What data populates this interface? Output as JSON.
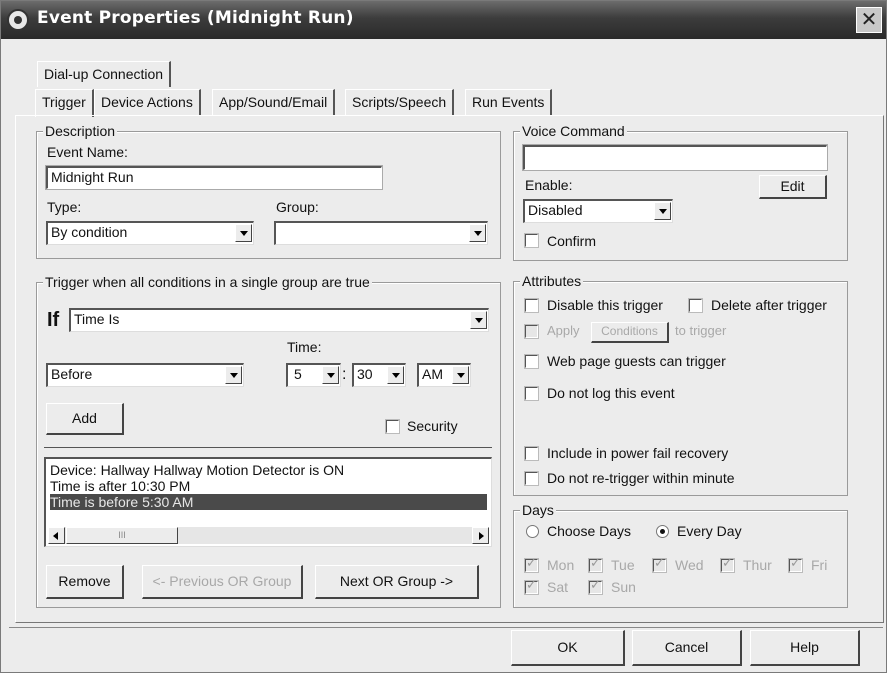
{
  "window": {
    "title": "Event Properties (Midnight Run)",
    "close_glyph": "✕"
  },
  "tabs_upper": [
    "Dial-up Connection"
  ],
  "tabs_lower": [
    "Trigger",
    "Device Actions",
    "App/Sound/Email",
    "Scripts/Speech",
    "Run Events"
  ],
  "active_tab": "Trigger",
  "description": {
    "legend": "Description",
    "event_name_label": "Event Name:",
    "event_name_value": "Midnight Run",
    "type_label": "Type:",
    "type_value": "By condition",
    "group_label": "Group:",
    "group_value": ""
  },
  "trigger_group": {
    "legend": "Trigger when all conditions in a single group are true",
    "if_label": "If",
    "condition_value": "Time Is",
    "time_label": "Time:",
    "relation_value": "Before",
    "hour_value": "5",
    "colon": ":",
    "minute_value": "30",
    "ampm_value": "AM",
    "add_label": "Add",
    "security_label": "Security",
    "conditions": [
      "Device: Hallway Hallway Motion Detector is ON",
      "Time is after 10:30 PM",
      "Time is before 5:30 AM"
    ],
    "selected_index": 2,
    "scroll_thumb_text": "III",
    "remove_label": "Remove",
    "prev_group_label": "<- Previous OR Group",
    "next_group_label": "Next OR Group ->"
  },
  "voice_command": {
    "legend": "Voice Command",
    "value": "",
    "enable_label": "Enable:",
    "edit_label": "Edit",
    "enable_value": "Disabled",
    "confirm_label": "Confirm"
  },
  "attributes": {
    "legend": "Attributes",
    "disable_trigger": "Disable this trigger",
    "delete_after": "Delete after trigger",
    "apply": "Apply",
    "conditions_btn": "Conditions",
    "to_trigger": "to trigger",
    "web_guests": "Web page guests can trigger",
    "no_log": "Do not log this event",
    "power_fail": "Include in power fail recovery",
    "no_retrigger": "Do not re-trigger within minute"
  },
  "days": {
    "legend": "Days",
    "choose_days": "Choose Days",
    "every_day": "Every Day",
    "selected": "Every Day",
    "row1": [
      "Mon",
      "Tue",
      "Wed",
      "Thur",
      "Fri"
    ],
    "row2": [
      "Sat",
      "Sun"
    ]
  },
  "buttons": {
    "ok": "OK",
    "cancel": "Cancel",
    "help": "Help"
  },
  "colors": {
    "titlebar": "#3c3c3c",
    "dialog_bg": "#ececec",
    "selection": "#4a4a4a"
  }
}
